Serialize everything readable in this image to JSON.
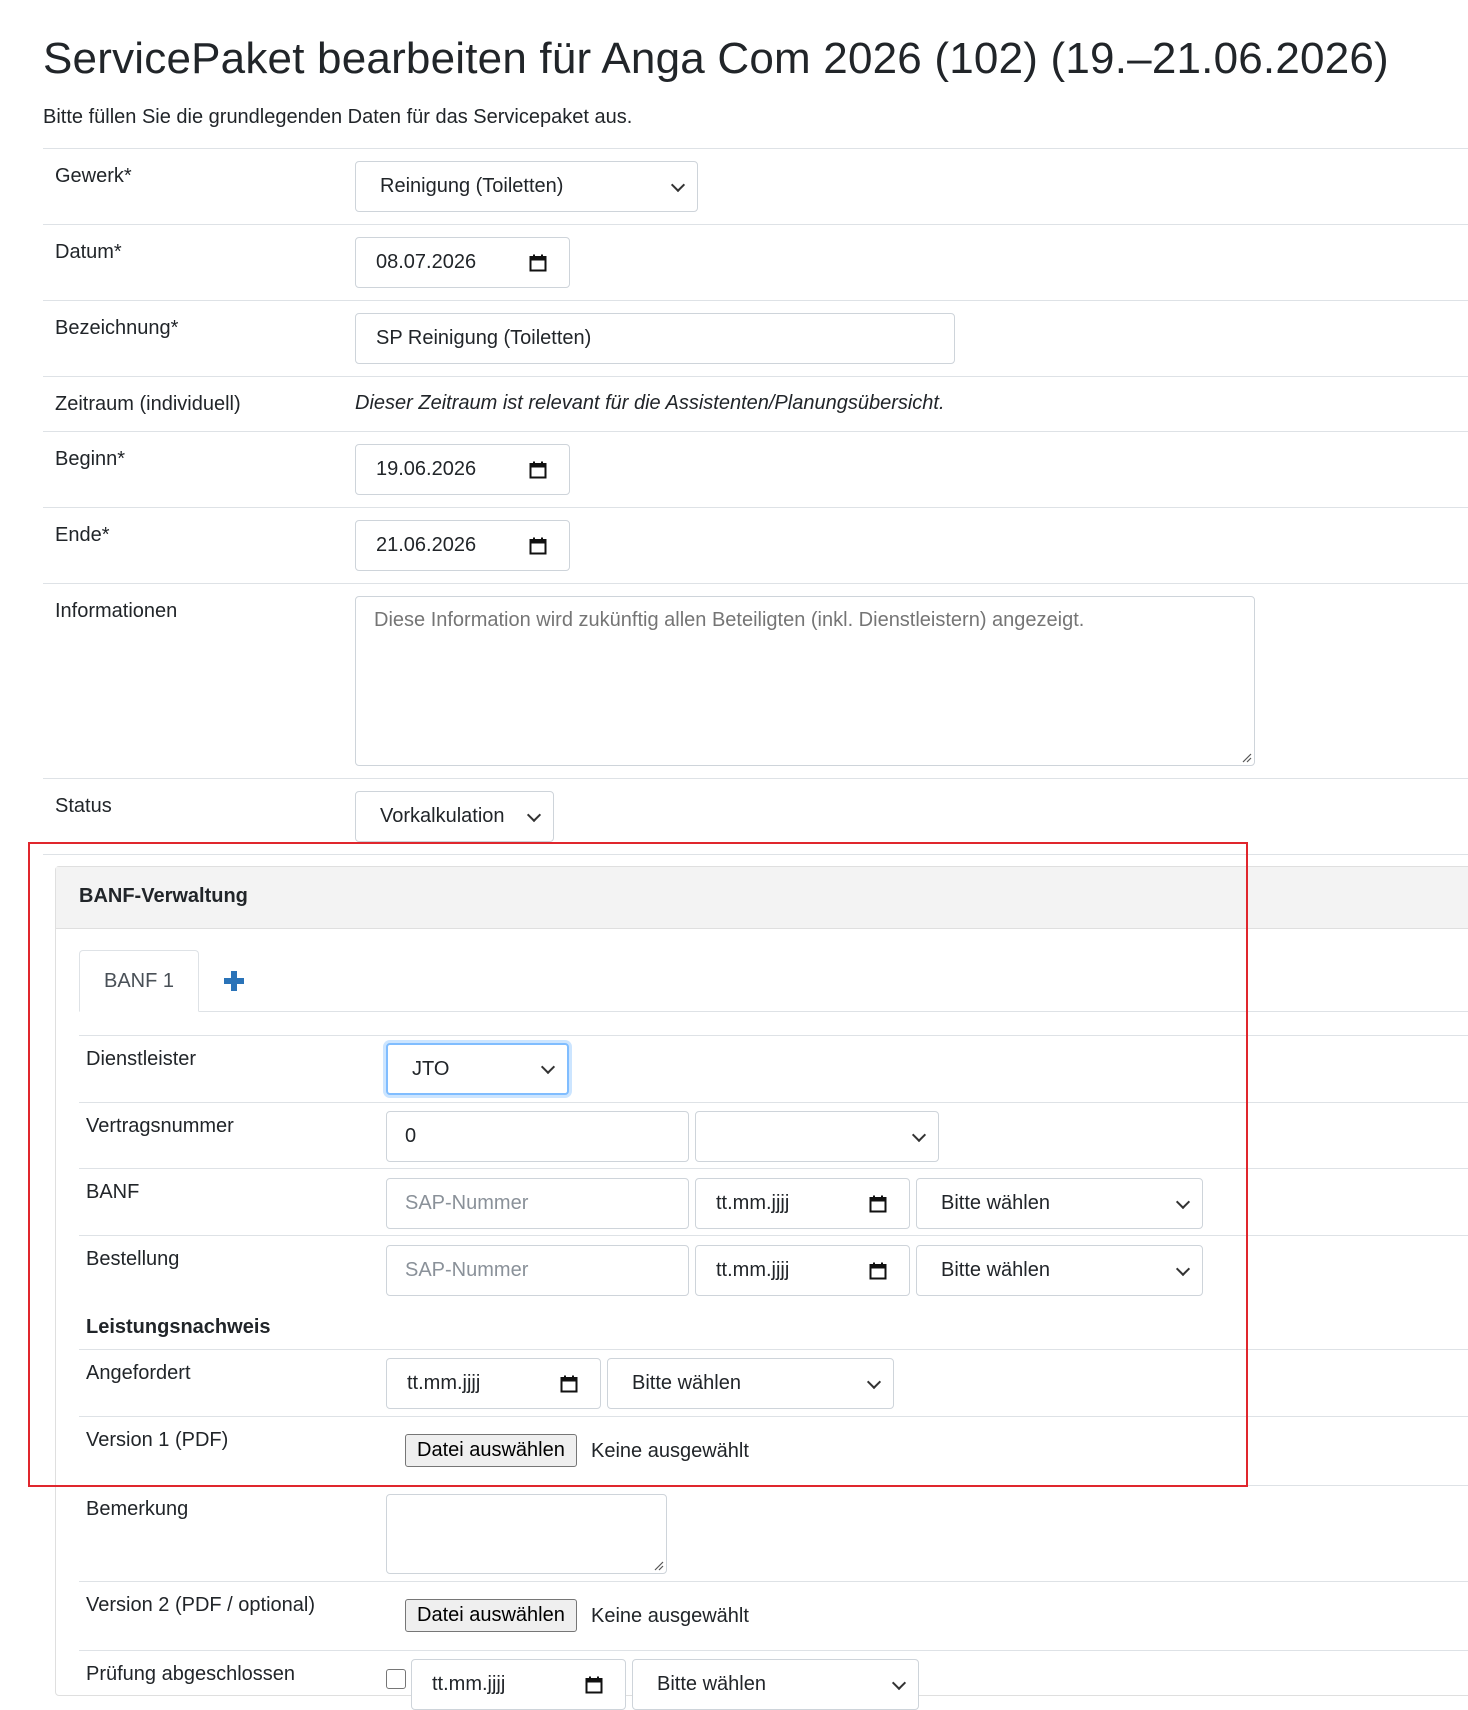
{
  "page": {
    "title": "ServicePaket bearbeiten für Anga Com 2026 (102) (19.–21.06.2026)",
    "intro": "Bitte füllen Sie die grundlegenden Daten für das Servicepaket aus."
  },
  "form": {
    "gewerk": {
      "label": "Gewerk*",
      "value": "Reinigung (Toiletten)"
    },
    "datum": {
      "label": "Datum*",
      "value": "08.07.2026"
    },
    "bezeichnung": {
      "label": "Bezeichnung*",
      "value": "SP Reinigung (Toiletten)"
    },
    "zeitraum": {
      "label": "Zeitraum (individuell)",
      "note": "Dieser Zeitraum ist relevant für die Assistenten/Planungsübersicht."
    },
    "beginn": {
      "label": "Beginn*",
      "value": "19.06.2026"
    },
    "ende": {
      "label": "Ende*",
      "value": "21.06.2026"
    },
    "informationen": {
      "label": "Informationen",
      "placeholder": "Diese Information wird zukünftig allen Beteiligten (inkl. Dienstleistern) angezeigt."
    },
    "status": {
      "label": "Status",
      "value": "Vorkalkulation"
    }
  },
  "banf": {
    "title": "BANF-Verwaltung",
    "tabs": [
      {
        "label": "BANF 1",
        "active": true
      }
    ],
    "add_icon": "plus-icon",
    "dienstleister": {
      "label": "Dienstleister",
      "value": "JTO"
    },
    "vertragsnummer": {
      "label": "Vertragsnummer",
      "value": "0",
      "select_value": ""
    },
    "banf_row": {
      "label": "BANF",
      "sap_placeholder": "SAP-Nummer",
      "date_placeholder": "tt.mm.jjjj",
      "select_value": "Bitte wählen"
    },
    "bestellung": {
      "label": "Bestellung",
      "sap_placeholder": "SAP-Nummer",
      "date_placeholder": "tt.mm.jjjj",
      "select_value": "Bitte wählen"
    },
    "leistungsnachweis": {
      "heading": "Leistungsnachweis"
    },
    "angefordert": {
      "label": "Angefordert",
      "date_placeholder": "tt.mm.jjjj",
      "select_value": "Bitte wählen"
    },
    "version1": {
      "label": "Version 1 (PDF)",
      "button": "Datei auswählen",
      "status": "Keine ausgewählt"
    },
    "bemerkung": {
      "label": "Bemerkung",
      "value": ""
    },
    "version2": {
      "label": "Version 2 (PDF / optional)",
      "button": "Datei auswählen",
      "status": "Keine ausgewählt"
    },
    "pruefung": {
      "label": "Prüfung abgeschlossen",
      "checked": false,
      "date_placeholder": "tt.mm.jjjj",
      "select_value": "Bitte wählen"
    }
  },
  "colors": {
    "highlight": "#e0262d",
    "accent_blue": "#2a73b8",
    "focus": "#80bdff"
  }
}
